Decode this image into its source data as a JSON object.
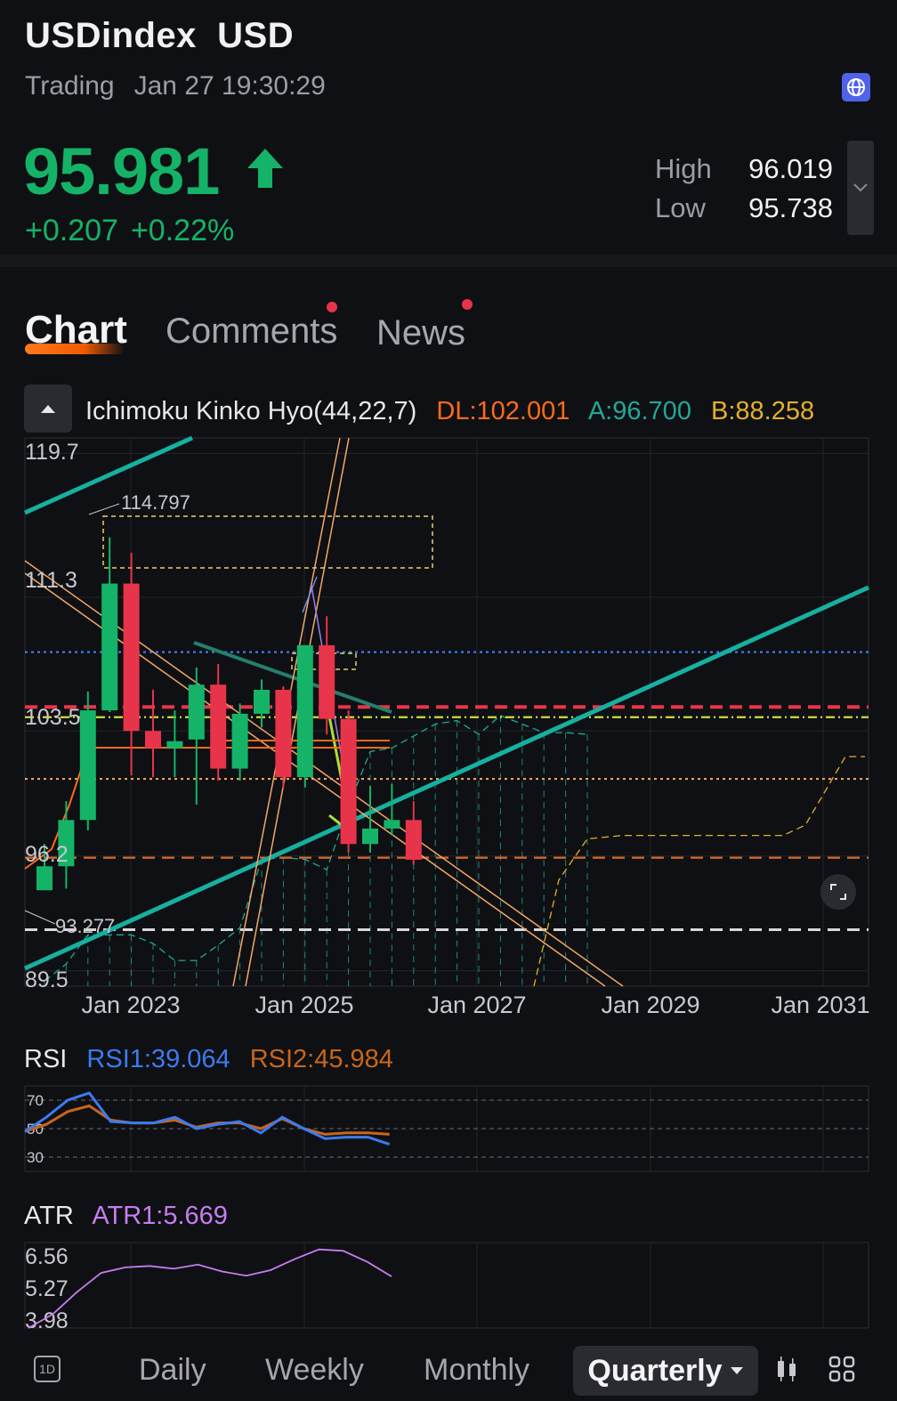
{
  "header": {
    "symbol": "USDindex",
    "currency": "USD",
    "status": "Trading",
    "time": "Jan 27 19:30:29"
  },
  "quote": {
    "price": "95.981",
    "change": "+0.207",
    "change_pct": "+0.22%",
    "high_label": "High",
    "high": "96.019",
    "low_label": "Low",
    "low": "95.738"
  },
  "tabs": {
    "chart": "Chart",
    "comments": "Comments",
    "news": "News"
  },
  "indicator": {
    "name": "Ichimoku Kinko Hyo(44,22,7)",
    "dl": "DL:102.001",
    "a": "A:96.700",
    "b": "B:88.258"
  },
  "rsi_panel": {
    "label": "RSI",
    "rsi1": "RSI1:39.064",
    "rsi2": "RSI2:45.984",
    "levels": [
      "70",
      "50",
      "30"
    ]
  },
  "atr_panel": {
    "label": "ATR",
    "atr1": "ATR1:5.669",
    "ticks": [
      "6.56",
      "5.27",
      "3.98"
    ]
  },
  "periods": {
    "daily": "Daily",
    "weekly": "Weekly",
    "monthly": "Monthly",
    "quarterly": "Quarterly",
    "day_icon": "1D"
  },
  "colors": {
    "up": "#14b368",
    "down": "#e8344a",
    "dl": "#ff6b1a",
    "span_a": "#1fa89a",
    "span_b": "#e3b02c",
    "rsi1": "#3c7bf0",
    "rsi2": "#c8661c",
    "atr1": "#c77df0"
  },
  "chart_data": {
    "type": "candlestick",
    "y_ticks": [
      "119.7",
      "111.3",
      "103.5",
      "96.2",
      "89.5"
    ],
    "ylim": [
      88.6,
      120.6
    ],
    "x_ticks": [
      "Jan 2023",
      "Jan 2025",
      "Jan 2027",
      "Jan 2029",
      "Jan 2031"
    ],
    "annotations": [
      "114.797",
      "93.277"
    ],
    "candles": [
      {
        "q": "2021Q4",
        "o": 94.2,
        "h": 96.9,
        "l": 94.2,
        "c": 95.6
      },
      {
        "q": "2022Q1",
        "o": 95.6,
        "h": 99.4,
        "l": 94.3,
        "c": 98.3
      },
      {
        "q": "2022Q2",
        "o": 98.3,
        "h": 105.8,
        "l": 97.7,
        "c": 104.7
      },
      {
        "q": "2022Q3",
        "o": 104.7,
        "h": 114.8,
        "l": 104.6,
        "c": 112.1
      },
      {
        "q": "2022Q4",
        "o": 112.1,
        "h": 113.9,
        "l": 100.9,
        "c": 103.5
      },
      {
        "q": "2023Q1",
        "o": 103.5,
        "h": 105.9,
        "l": 100.8,
        "c": 102.5
      },
      {
        "q": "2023Q2",
        "o": 102.5,
        "h": 104.7,
        "l": 100.8,
        "c": 102.9
      },
      {
        "q": "2023Q3",
        "o": 103.0,
        "h": 107.2,
        "l": 99.2,
        "c": 106.2
      },
      {
        "q": "2023Q4",
        "o": 106.2,
        "h": 107.4,
        "l": 100.6,
        "c": 101.3
      },
      {
        "q": "2024Q1",
        "o": 101.3,
        "h": 105.1,
        "l": 100.6,
        "c": 104.5
      },
      {
        "q": "2024Q2",
        "o": 104.5,
        "h": 106.5,
        "l": 103.7,
        "c": 105.9
      },
      {
        "q": "2024Q3",
        "o": 105.9,
        "h": 106.1,
        "l": 100.2,
        "c": 100.8
      },
      {
        "q": "2024Q4",
        "o": 100.8,
        "h": 108.5,
        "l": 100.2,
        "c": 108.5
      },
      {
        "q": "2025Q1",
        "o": 108.5,
        "h": 110.2,
        "l": 103.3,
        "c": 104.2
      },
      {
        "q": "2025Q2",
        "o": 104.2,
        "h": 104.7,
        "l": 96.4,
        "c": 96.9
      },
      {
        "q": "2025Q3",
        "o": 96.9,
        "h": 100.3,
        "l": 96.4,
        "c": 97.8
      },
      {
        "q": "2025Q4",
        "o": 97.8,
        "h": 100.4,
        "l": 97.4,
        "c": 98.3
      },
      {
        "q": "2026Q1",
        "o": 98.3,
        "h": 99.4,
        "l": 95.7,
        "c": 95.981
      }
    ],
    "horizontal_lines": [
      {
        "y": 108.1,
        "color": "#3c7bf0",
        "style": "dotted"
      },
      {
        "y": 104.9,
        "color": "#e8344a",
        "style": "dashed"
      },
      {
        "y": 104.3,
        "color": "#c9e03a",
        "style": "dashdot"
      },
      {
        "y": 100.7,
        "color": "#f0a060",
        "style": "dotted"
      },
      {
        "y": 96.1,
        "color": "#d96a2a",
        "style": "dashed"
      },
      {
        "y": 91.9,
        "color": "#d8d8dc",
        "style": "dashed"
      }
    ],
    "rsi": {
      "ylim": [
        20,
        80
      ],
      "rsi1": [
        48,
        58,
        70,
        75,
        55,
        54,
        54,
        58,
        50,
        53,
        55,
        47,
        58,
        50,
        43,
        44,
        44,
        39
      ],
      "rsi2": [
        48,
        53,
        62,
        66,
        56,
        54,
        54,
        56,
        51,
        54,
        54,
        50,
        57,
        50,
        46,
        47,
        47,
        46
      ]
    },
    "atr": {
      "ylim": [
        3.8,
        6.9
      ],
      "atr1": [
        3.7,
        4.3,
        5.1,
        5.8,
        6.0,
        6.05,
        5.95,
        6.1,
        5.85,
        5.7,
        5.9,
        6.3,
        6.65,
        6.6,
        6.2,
        5.67
      ]
    }
  }
}
